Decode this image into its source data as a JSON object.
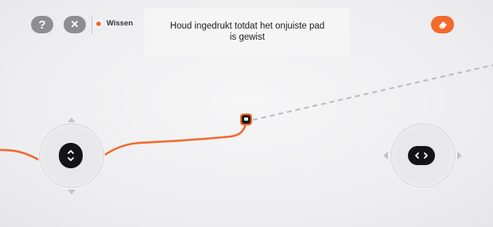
{
  "toolbar": {
    "help_glyph": "?",
    "close_glyph": "✕",
    "erase_mode_label": "Wissen"
  },
  "instruction": {
    "text": "Houd ingedrukt totdat het onjuiste pad is gewist"
  },
  "icons": {
    "help": "question-icon",
    "close": "close-icon",
    "eraser": "eraser-icon",
    "robot": "robot-icon",
    "vertical_joystick": "up-down-chevron-icon",
    "horizontal_joystick": "left-right-chevron-icon"
  },
  "colors": {
    "accent": "#f26a2c",
    "button_gray": "#8e8e92",
    "knob": "#141416",
    "planned_path": "#b9b9bc"
  }
}
